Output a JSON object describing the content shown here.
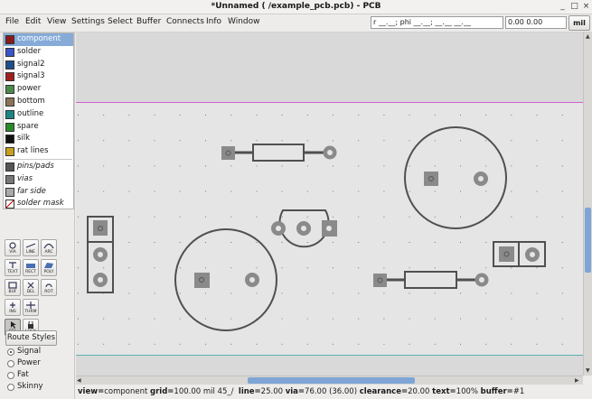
{
  "window": {
    "title": "*Unnamed (                                        /example_pcb.pcb) - PCB",
    "minimize_glyph": "_",
    "maximize_glyph": "□",
    "close_glyph": "×"
  },
  "menu": [
    {
      "label": "File"
    },
    {
      "label": "Edit"
    },
    {
      "label": "View"
    },
    {
      "label": "Settings"
    },
    {
      "label": "Select"
    },
    {
      "label": "Buffer"
    },
    {
      "label": "Connects"
    },
    {
      "label": "Info"
    },
    {
      "label": "Window"
    }
  ],
  "cursor_field": "r __.__; phi __.__; __.__ __.__",
  "coord_field": "0.00 0.00",
  "units_button": "mil",
  "layers": [
    {
      "label": "component",
      "color": "#8b1a1a",
      "selected": true
    },
    {
      "label": "solder",
      "color": "#3a55c8"
    },
    {
      "label": "signal2",
      "color": "#1f4f8a"
    },
    {
      "label": "signal3",
      "color": "#a02020"
    },
    {
      "label": "power",
      "color": "#4c8a4c"
    },
    {
      "label": "bottom",
      "color": "#8a7355"
    },
    {
      "label": "outline",
      "color": "#1d8585"
    },
    {
      "label": "spare",
      "color": "#2a8a2a"
    },
    {
      "label": "silk",
      "color": "#111111"
    },
    {
      "label": "rat lines",
      "color": "#c8a020"
    }
  ],
  "special_layers": [
    {
      "label": "pins/pads",
      "color": "#555555"
    },
    {
      "label": "vias",
      "color": "#777777"
    },
    {
      "label": "far side",
      "color": "#aaaaaa"
    },
    {
      "label": "solder mask",
      "color": "#ffffff"
    }
  ],
  "tools": [
    {
      "label": "VIA"
    },
    {
      "label": "LINE"
    },
    {
      "label": "ARC"
    },
    {
      "label": "TEXT"
    },
    {
      "label": "RECT"
    },
    {
      "label": "POLY"
    },
    {
      "label": "BUF"
    },
    {
      "label": "DEL"
    },
    {
      "label": "ROT"
    },
    {
      "label": "INS"
    },
    {
      "label": "THRM"
    },
    {
      "label": "SEL"
    },
    {
      "label": "LOCK"
    }
  ],
  "route_styles_button": "Route Styles",
  "route_styles": [
    {
      "label": "Signal",
      "selected": true
    },
    {
      "label": "Power"
    },
    {
      "label": "Fat"
    },
    {
      "label": "Skinny"
    }
  ],
  "status": {
    "view_key": "view=",
    "view_val": "component",
    "grid_key": "grid=",
    "grid_val": "100.00 mil  45_/",
    "line_key": "line=",
    "line_val": "25.00",
    "via_key": "via=",
    "via_val": "76.00 (36.00)",
    "clearance_key": "clearance=",
    "clearance_val": "20.00",
    "text_key": "text=",
    "text_val": "100%",
    "buffer_key": "buffer=",
    "buffer_val": "#1"
  },
  "colors": {
    "board": "#e5e5e5",
    "offboard": "#d9d9d9",
    "silk": "#505050",
    "pad": "#8a8a8a",
    "board_top_edge": "#d060d0",
    "board_bottom_edge": "#60b0b0",
    "selected_layer": "#86abd9",
    "scroll_thumb": "#7fa5d6"
  }
}
